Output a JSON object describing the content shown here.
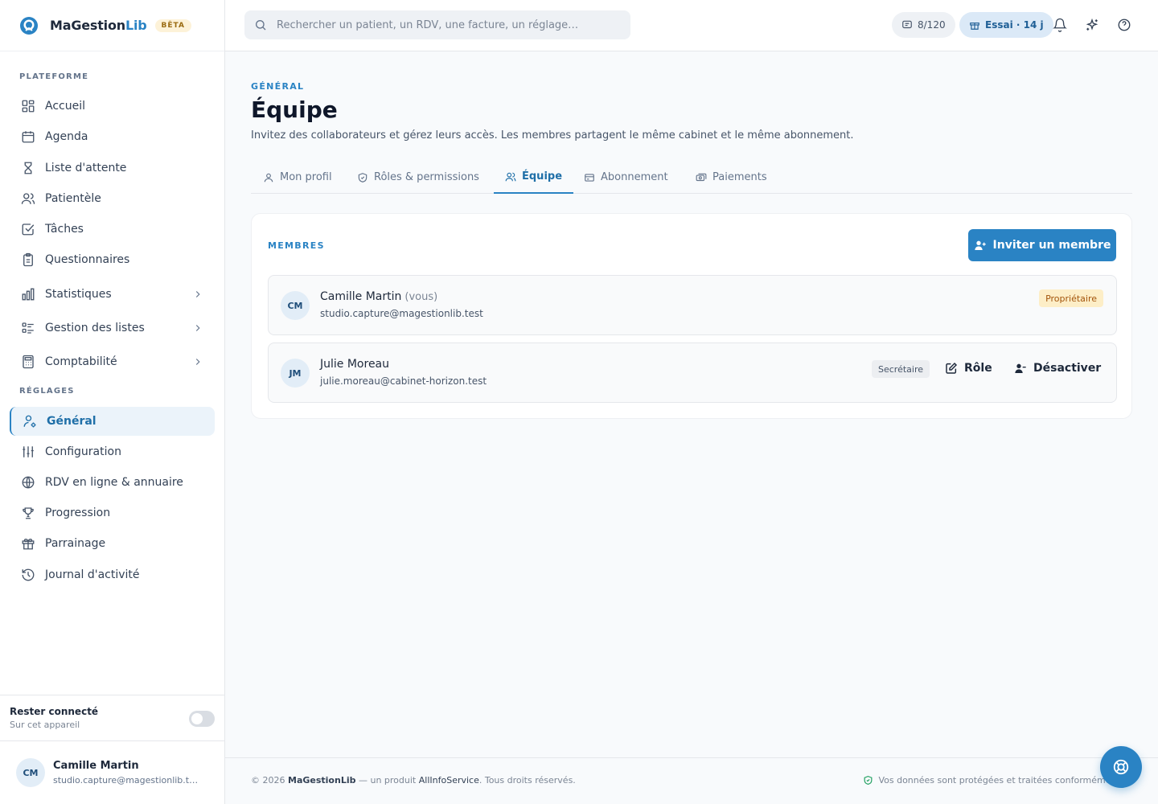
{
  "app": {
    "name_main": "MaGestion",
    "name_accent": "Lib",
    "beta": "BÊTA"
  },
  "sidebar": {
    "platform_label": "PLATEFORME",
    "settings_label": "RÉGLAGES",
    "platform_items": [
      {
        "label": "Accueil",
        "icon": "dashboard-icon"
      },
      {
        "label": "Agenda",
        "icon": "calendar-icon"
      },
      {
        "label": "Liste d'attente",
        "icon": "hourglass-icon"
      },
      {
        "label": "Patientèle",
        "icon": "users-icon"
      },
      {
        "label": "Tâches",
        "icon": "checkbox-icon"
      },
      {
        "label": "Questionnaires",
        "icon": "clipboard-icon"
      },
      {
        "label": "Statistiques",
        "icon": "bar-chart-icon"
      },
      {
        "label": "Gestion des listes",
        "icon": "list-icon"
      },
      {
        "label": "Comptabilité",
        "icon": "calculator-icon"
      }
    ],
    "settings_items": [
      {
        "label": "Général",
        "icon": "user-cog-icon",
        "active": true
      },
      {
        "label": "Configuration",
        "icon": "sliders-icon"
      },
      {
        "label": "RDV en ligne & annuaire",
        "icon": "globe-icon"
      },
      {
        "label": "Progression",
        "icon": "trophy-icon"
      },
      {
        "label": "Parrainage",
        "icon": "gift-icon"
      },
      {
        "label": "Journal d'activité",
        "icon": "history-icon"
      }
    ],
    "stay_connected": {
      "title": "Rester connecté",
      "subtitle": "Sur cet appareil",
      "enabled": false
    },
    "user": {
      "initials": "CM",
      "name": "Camille Martin",
      "email": "studio.capture@magestionlib.test"
    }
  },
  "header": {
    "search_placeholder": "Rechercher un patient, un RDV, une facture, un réglage…",
    "usage": "8/120",
    "trial": "Essai · 14 j"
  },
  "page": {
    "overline": "GÉNÉRAL",
    "title": "Équipe",
    "description": "Invitez des collaborateurs et gérez leurs accès. Les membres partagent le même cabinet et le même abonnement.",
    "tabs": [
      {
        "label": "Mon profil",
        "icon": "user-icon"
      },
      {
        "label": "Rôles & permissions",
        "icon": "shield-icon"
      },
      {
        "label": "Équipe",
        "icon": "users-icon",
        "active": true
      },
      {
        "label": "Abonnement",
        "icon": "credit-card-icon"
      },
      {
        "label": "Paiements",
        "icon": "cash-icon"
      }
    ]
  },
  "members": {
    "label": "MEMBRES",
    "invite_button": "Inviter un membre",
    "list": [
      {
        "initials": "CM",
        "name": "Camille Martin",
        "you": "(vous)",
        "email": "studio.capture@magestionlib.test",
        "role": "Propriétaire"
      },
      {
        "initials": "JM",
        "name": "Julie Moreau",
        "email": "julie.moreau@cabinet-horizon.test",
        "role": "Secrétaire",
        "role_action": "Rôle",
        "deactivate_action": "Désactiver"
      }
    ]
  },
  "footer": {
    "copyright": "© 2026",
    "brand": "MaGestionLib",
    "middle": "— un produit",
    "company": "AllInfoService",
    "rights": ". Tous droits réservés.",
    "privacy": "Vos données sont protégées et traitées conformément au"
  },
  "colors": {
    "accent": "#2a83c4",
    "owner_badge": "#fdeec7",
    "beta_badge": "#fdf2d8"
  }
}
